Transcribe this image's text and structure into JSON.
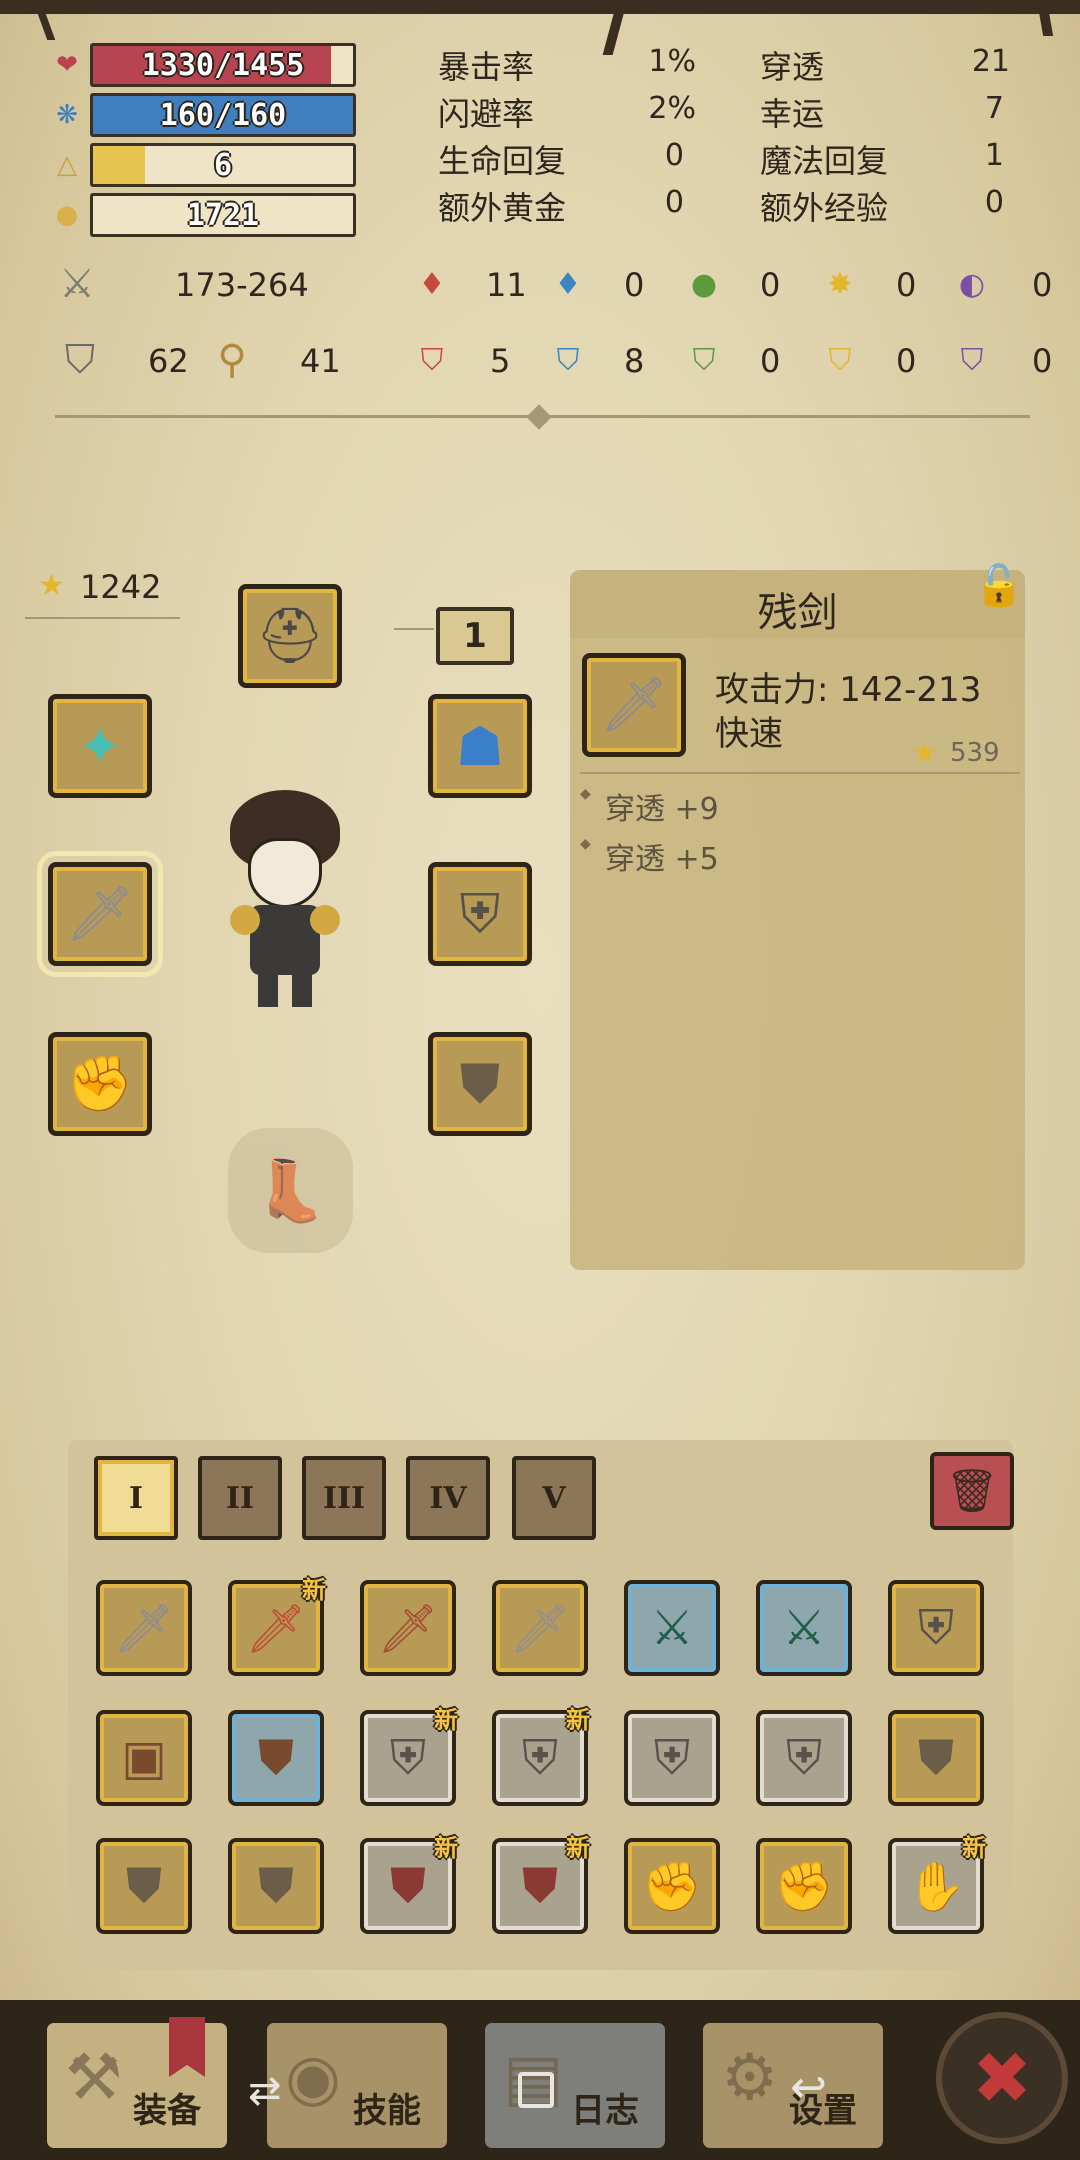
{
  "stats": {
    "hp": {
      "text": "1330/1455",
      "fraction": 0.914,
      "color": "#b74450"
    },
    "mp": {
      "text": "160/160",
      "fraction": 1.0,
      "color": "#3f7fc0"
    },
    "level": {
      "text": "6",
      "fraction": 0.2,
      "color": "#e7c350"
    },
    "gold": {
      "text": "1721",
      "fraction": 0.0,
      "color": "#d9b04b"
    }
  },
  "attributes": [
    {
      "label": "暴击率",
      "value": "1%"
    },
    {
      "label": "闪避率",
      "value": "2%"
    },
    {
      "label": "生命回复",
      "value": "0"
    },
    {
      "label": "额外黄金",
      "value": "0"
    },
    {
      "label": "穿透",
      "value": "21"
    },
    {
      "label": "幸运",
      "value": "7"
    },
    {
      "label": "魔法回复",
      "value": "1"
    },
    {
      "label": "额外经验",
      "value": "0"
    }
  ],
  "combat": {
    "attack_range": "173-264",
    "armor": "62",
    "magic": "41",
    "elements_attack": [
      "11",
      "0",
      "0",
      "0",
      "0"
    ],
    "elements_defense": [
      "5",
      "8",
      "0",
      "0",
      "0"
    ]
  },
  "equipment": {
    "gear_score": "1242",
    "level_badge": "1"
  },
  "item_detail": {
    "name": "残剑",
    "stat_line": "攻击力: 142-213",
    "speed": "快速",
    "score": "539",
    "bonuses": [
      "穿透 +9",
      "穿透 +5"
    ]
  },
  "inventory": {
    "tabs": [
      "I",
      "II",
      "III",
      "IV",
      "V"
    ],
    "new_label": "新"
  },
  "nav": {
    "equip": "装备",
    "skills": "技能",
    "log": "日志",
    "settings": "设置"
  }
}
